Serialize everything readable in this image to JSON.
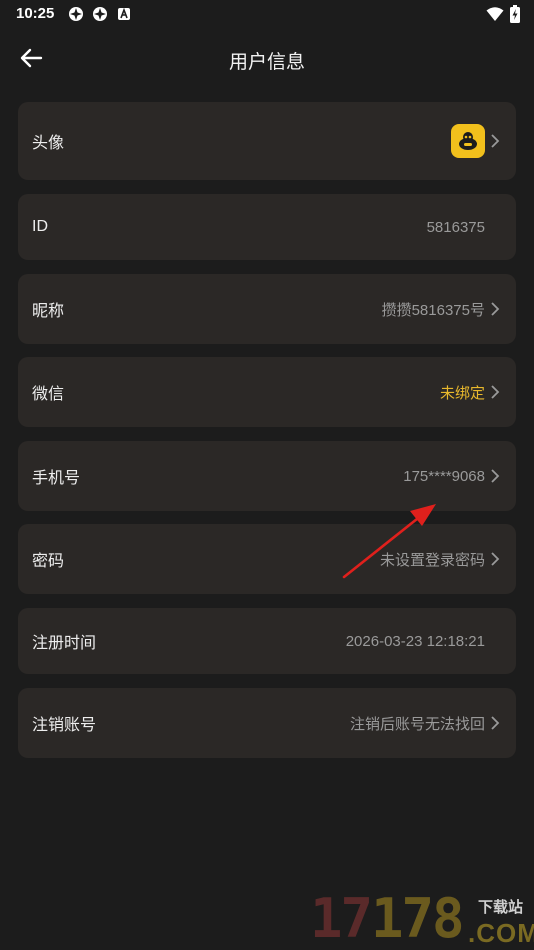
{
  "status_bar": {
    "time": "10:25",
    "icons": [
      "app-icon",
      "app-icon",
      "notification-icon"
    ],
    "right_icons": [
      "wifi-icon",
      "battery-charging-icon"
    ]
  },
  "header": {
    "title": "用户信息",
    "back_icon": "arrow-left-icon"
  },
  "rows": [
    {
      "label": "头像",
      "value": "",
      "type": "avatar",
      "chevron": true
    },
    {
      "label": "ID",
      "value": "5816375",
      "type": "text",
      "chevron": false
    },
    {
      "label": "昵称",
      "value": "攒攒5816375号",
      "type": "text",
      "chevron": true
    },
    {
      "label": "微信",
      "value": "未绑定",
      "type": "warn",
      "chevron": true
    },
    {
      "label": "手机号",
      "value": "175****9068",
      "type": "text",
      "chevron": true
    },
    {
      "label": "密码",
      "value": "未设置登录密码",
      "type": "text",
      "chevron": true
    },
    {
      "label": "注册时间",
      "value": "2026-03-23 12:18:21",
      "type": "text",
      "chevron": false
    },
    {
      "label": "注销账号",
      "value": "注销后账号无法找回",
      "type": "text",
      "chevron": true
    }
  ],
  "colors": {
    "background": "#1c1c1c",
    "row_background": "#2b2826",
    "warn": "#e8b82c",
    "avatar_bg": "#f2c01c"
  },
  "watermark": {
    "number_red": "17",
    "number_yellow": "178",
    "site": "下载站",
    "domain": ".COM"
  }
}
